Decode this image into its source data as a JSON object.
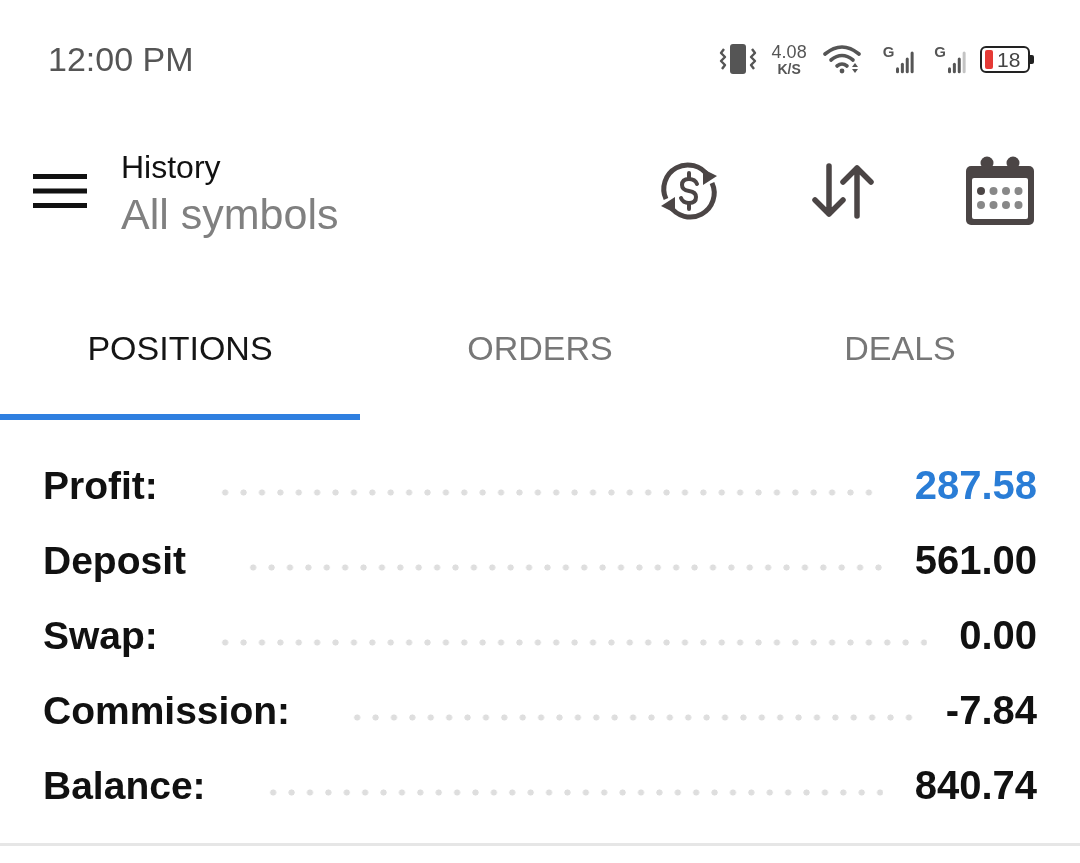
{
  "status_bar": {
    "time": "12:00 PM",
    "net_speed": "4.08",
    "net_speed_unit": "K/S",
    "sim_1_network": "G",
    "sim_2_network": "G",
    "battery": "18"
  },
  "header": {
    "title": "History",
    "subtitle": "All symbols"
  },
  "tabs": [
    {
      "label": "POSITIONS",
      "selected": true
    },
    {
      "label": "ORDERS",
      "selected": false
    },
    {
      "label": "DEALS",
      "selected": false
    }
  ],
  "summary": [
    {
      "label": "Profit:",
      "value": "287.58",
      "color": "#2a7dd6"
    },
    {
      "label": "Deposit",
      "value": "561.00",
      "color": "#111111"
    },
    {
      "label": "Swap:",
      "value": "0.00",
      "color": "#111111"
    },
    {
      "label": "Commission:",
      "value": "-7.84",
      "color": "#111111"
    },
    {
      "label": "Balance:",
      "value": "840.74",
      "color": "#111111"
    }
  ]
}
